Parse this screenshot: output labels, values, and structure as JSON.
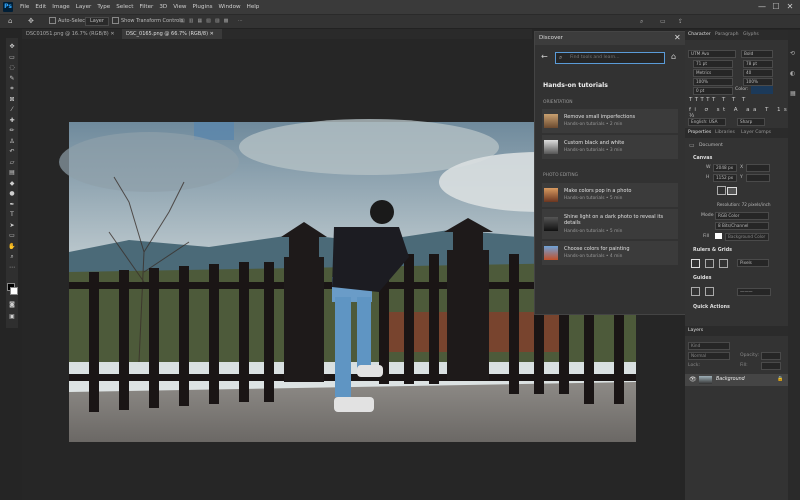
{
  "menubar": {
    "logo": "Ps",
    "items": [
      "File",
      "Edit",
      "Image",
      "Layer",
      "Type",
      "Select",
      "Filter",
      "3D",
      "View",
      "Plugins",
      "Window",
      "Help"
    ],
    "controls": [
      "—",
      "☐",
      "✕"
    ]
  },
  "options": {
    "auto_select_label": "Auto-Select:",
    "auto_select_value": "Layer",
    "transform_label": "Show Transform Controls"
  },
  "tabs": [
    {
      "label": "DSC01051.png @ 16.7% (RGB/8)",
      "active": false
    },
    {
      "label": "DSC_0165.png @ 66.7% (RGB/8)",
      "active": true
    }
  ],
  "discover": {
    "title": "Discover",
    "search_placeholder": "Find tools and learn...",
    "heading": "Hands-on tutorials",
    "sections": [
      {
        "label": "ORIENTATION",
        "items": [
          {
            "title": "Remove small imperfections",
            "meta": "Hands-on tutorials • 2 min"
          },
          {
            "title": "Custom black and white",
            "meta": "Hands-on tutorials • 3 min"
          }
        ]
      },
      {
        "label": "PHOTO EDITING",
        "items": [
          {
            "title": "Make colors pop in a photo",
            "meta": "Hands-on tutorials • 5 min"
          },
          {
            "title": "Shine light on a dark photo to reveal its details",
            "meta": "Hands-on tutorials • 5 min"
          },
          {
            "title": "Choose colors for painting",
            "meta": "Hands-on tutorials • 4 min"
          }
        ]
      }
    ]
  },
  "character": {
    "tabs": [
      "Character",
      "Paragraph",
      "Glyphs"
    ],
    "font": "UTM Avo",
    "style": "Bold",
    "size": "71 pt",
    "leading": "78 pt",
    "kerning": "Metrics",
    "tracking": "40",
    "vscale": "100%",
    "hscale": "100%",
    "baseline": "0 pt",
    "color_label": "Color:",
    "language": "English: USA",
    "aa": "Sharp"
  },
  "properties": {
    "tabs": [
      "Properties",
      "Libraries",
      "Layer Comps"
    ],
    "doc_label": "Document",
    "canvas_label": "Canvas",
    "w_label": "W",
    "w_value": "2048 px",
    "h_label": "H",
    "h_value": "1152 px",
    "x_label": "X",
    "y_label": "Y",
    "resolution": "Resolution: 72 pixels/inch",
    "mode_label": "Mode",
    "mode_value": "RGB Color",
    "depth_value": "8 Bits/Channel",
    "fill_label": "Fill",
    "fill_value": "Background Color",
    "rulers_label": "Rulers & Grids",
    "units": "Pixels",
    "guides_label": "Guides",
    "quick_actions": "Quick Actions"
  },
  "layers": {
    "tab": "Layers",
    "kind_placeholder": "Kind",
    "blend": "Normal",
    "opacity_label": "Opacity:",
    "lock_label": "Lock:",
    "fill_label": "Fill:",
    "layer_name": "Background"
  },
  "colors": {
    "accent": "#31a8ff",
    "panel": "#333333",
    "foreground": "#000000",
    "background": "#ffffff",
    "char_color": "#1c3a5a"
  }
}
